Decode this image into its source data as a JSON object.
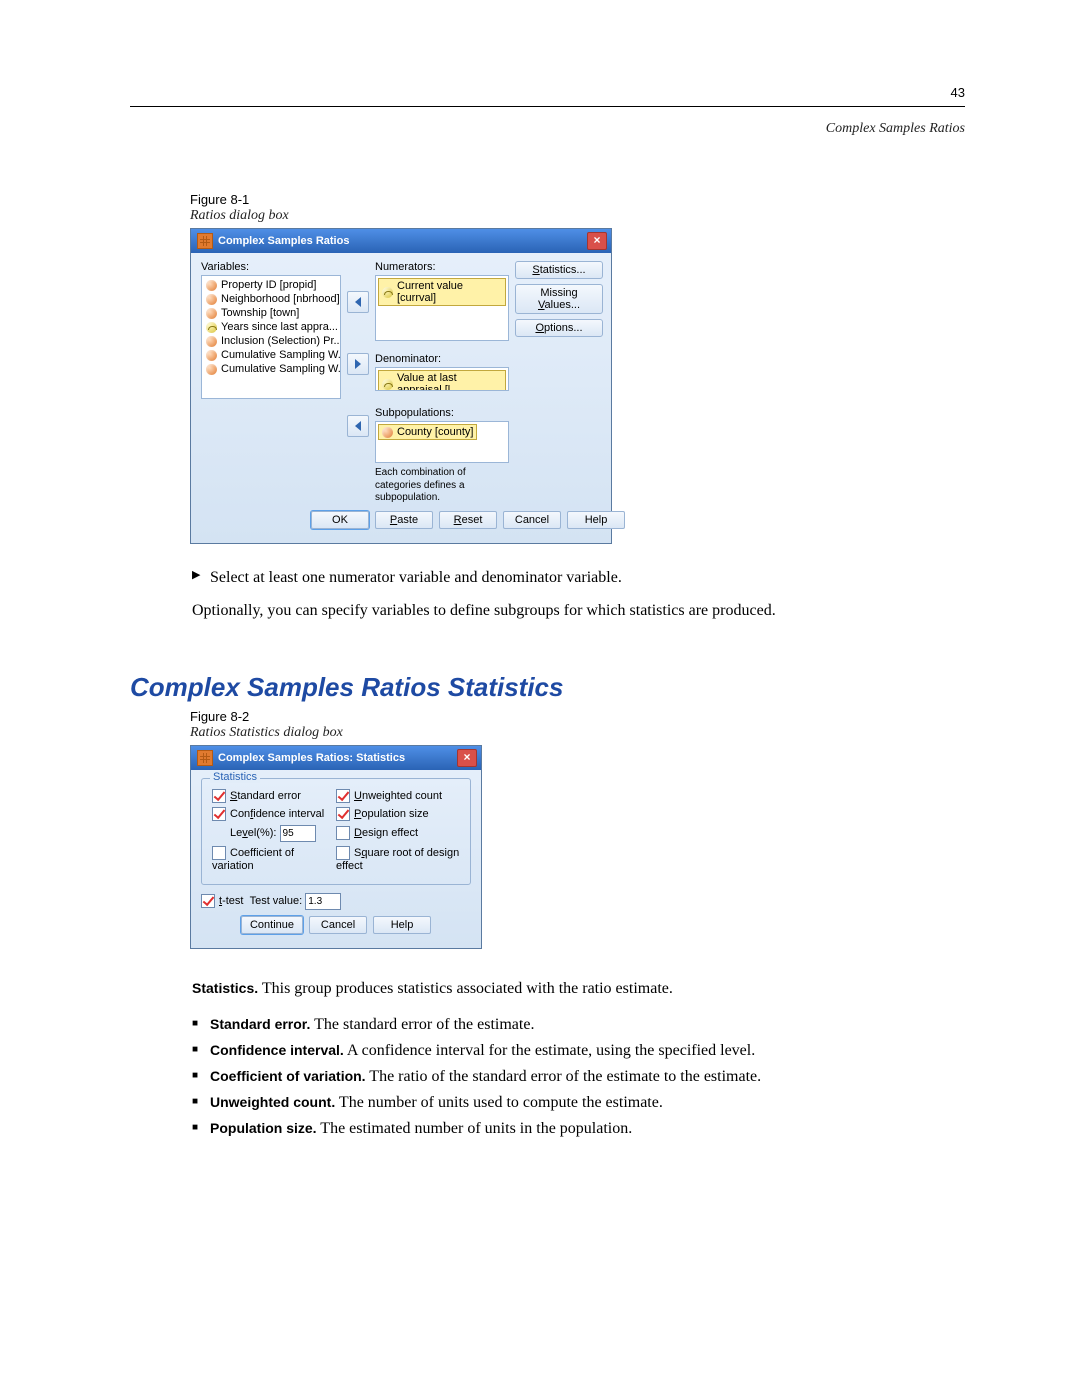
{
  "pageNumber": "43",
  "runningHead": "Complex Samples Ratios",
  "figure1": {
    "label": "Figure 8-1",
    "caption": "Ratios dialog box"
  },
  "dialog1": {
    "title": "Complex Samples Ratios",
    "labels": {
      "variables": "Variables:",
      "numerators": "Numerators:",
      "denominator": "Denominator:",
      "subpopulations": "Subpopulations:"
    },
    "variables": [
      "Property ID [propid]",
      "Neighborhood [nbrhood]",
      "Township [town]",
      "Years since last appra...",
      "Inclusion (Selection) Pr...",
      "Cumulative Sampling W...",
      "Cumulative Sampling W..."
    ],
    "varIcons": [
      "nom",
      "nom",
      "nom",
      "scale",
      "nom",
      "nom",
      "nom"
    ],
    "numeratorSel": "Current value [currval]",
    "denominatorSel": "Value at last appraisal [l...",
    "subpopSel": "County [county]",
    "hint": "Each combination of categories defines a subpopulation.",
    "sideButtons": [
      "Statistics",
      "Missing Values",
      "Options"
    ],
    "footer": [
      "OK",
      "Paste",
      "Reset",
      "Cancel",
      "Help"
    ]
  },
  "bodyLine1": "Select at least one numerator variable and denominator variable.",
  "bodyLine2": "Optionally, you can specify variables to define subgroups for which statistics are produced.",
  "sectionHeading": "Complex Samples Ratios Statistics",
  "figure2": {
    "label": "Figure 8-2",
    "caption": "Ratios Statistics dialog box"
  },
  "dialog2": {
    "title": "Complex Samples Ratios: Statistics",
    "groupLabel": "Statistics",
    "rows": [
      {
        "left": {
          "label": "Standard error",
          "checked": true
        },
        "right": {
          "label": "Unweighted count",
          "checked": true
        }
      },
      {
        "left": {
          "label": "Confidence interval",
          "checked": true
        },
        "right": {
          "label": "Population size",
          "checked": true
        }
      },
      {
        "left": {
          "label": "Level(%):",
          "value": "95",
          "isInput": true
        },
        "right": {
          "label": "Design effect",
          "checked": false
        }
      },
      {
        "left": {
          "label": "Coefficient of variation",
          "checked": false
        },
        "right": {
          "label": "Square root of design effect",
          "checked": false
        }
      }
    ],
    "ttest": {
      "checked": true,
      "label": "t-test",
      "testValueLabel": "Test value:",
      "testValue": "1.3"
    },
    "footer": [
      "Continue",
      "Cancel",
      "Help"
    ]
  },
  "statsIntro": {
    "bold": "Statistics.",
    "rest": " This group produces statistics associated with the ratio estimate."
  },
  "statBullets": [
    {
      "bold": "Standard error.",
      "rest": " The standard error of the estimate."
    },
    {
      "bold": "Confidence interval.",
      "rest": " A confidence interval for the estimate, using the specified level."
    },
    {
      "bold": "Coefficient of variation.",
      "rest": " The ratio of the standard error of the estimate to the estimate."
    },
    {
      "bold": "Unweighted count.",
      "rest": " The number of units used to compute the estimate."
    },
    {
      "bold": "Population size.",
      "rest": " The estimated number of units in the population."
    }
  ]
}
